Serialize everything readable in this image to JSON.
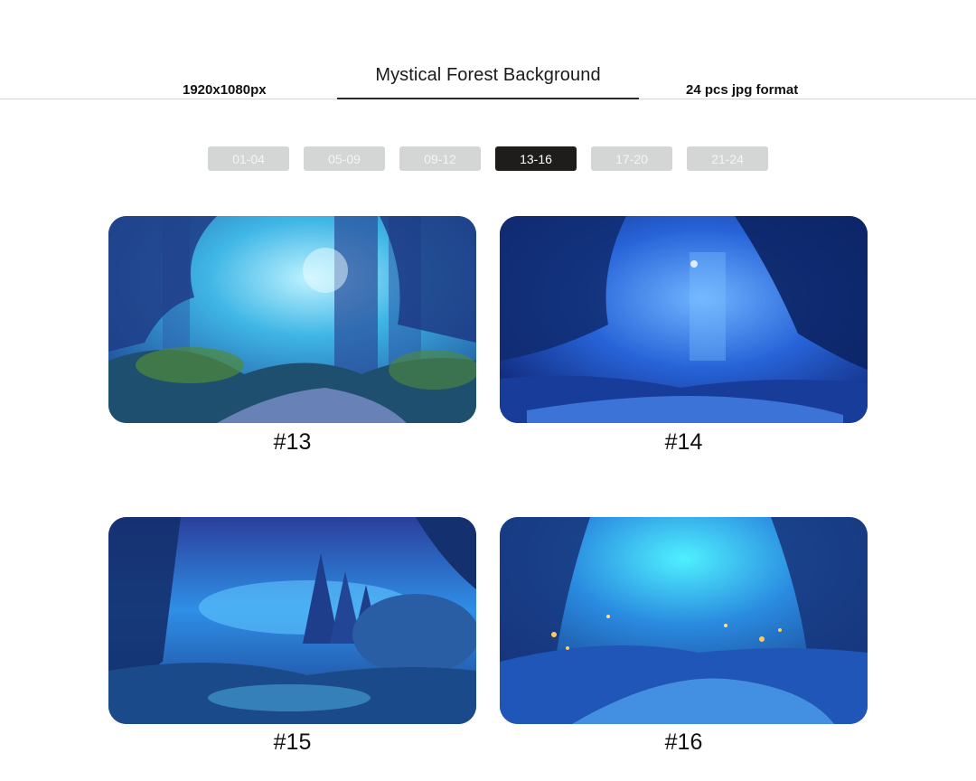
{
  "header": {
    "title": "Mystical Forest Background",
    "resolution": "1920x1080px",
    "count_format": "24 pcs jpg format"
  },
  "tabs": [
    {
      "label": "01-04",
      "active": false
    },
    {
      "label": "05-09",
      "active": false
    },
    {
      "label": "09-12",
      "active": false
    },
    {
      "label": "13-16",
      "active": true
    },
    {
      "label": "17-20",
      "active": false
    },
    {
      "label": "21-24",
      "active": false
    }
  ],
  "gallery": [
    {
      "caption": "#13",
      "scene": "forest-path"
    },
    {
      "caption": "#14",
      "scene": "forest-stream"
    },
    {
      "caption": "#15",
      "scene": "night-sky-forest"
    },
    {
      "caption": "#16",
      "scene": "firefly-river"
    }
  ],
  "colors": {
    "active_tab": "#1f1c1c",
    "inactive_tab": "#d4d6d6",
    "accent_blue": "#1e6fe0"
  }
}
